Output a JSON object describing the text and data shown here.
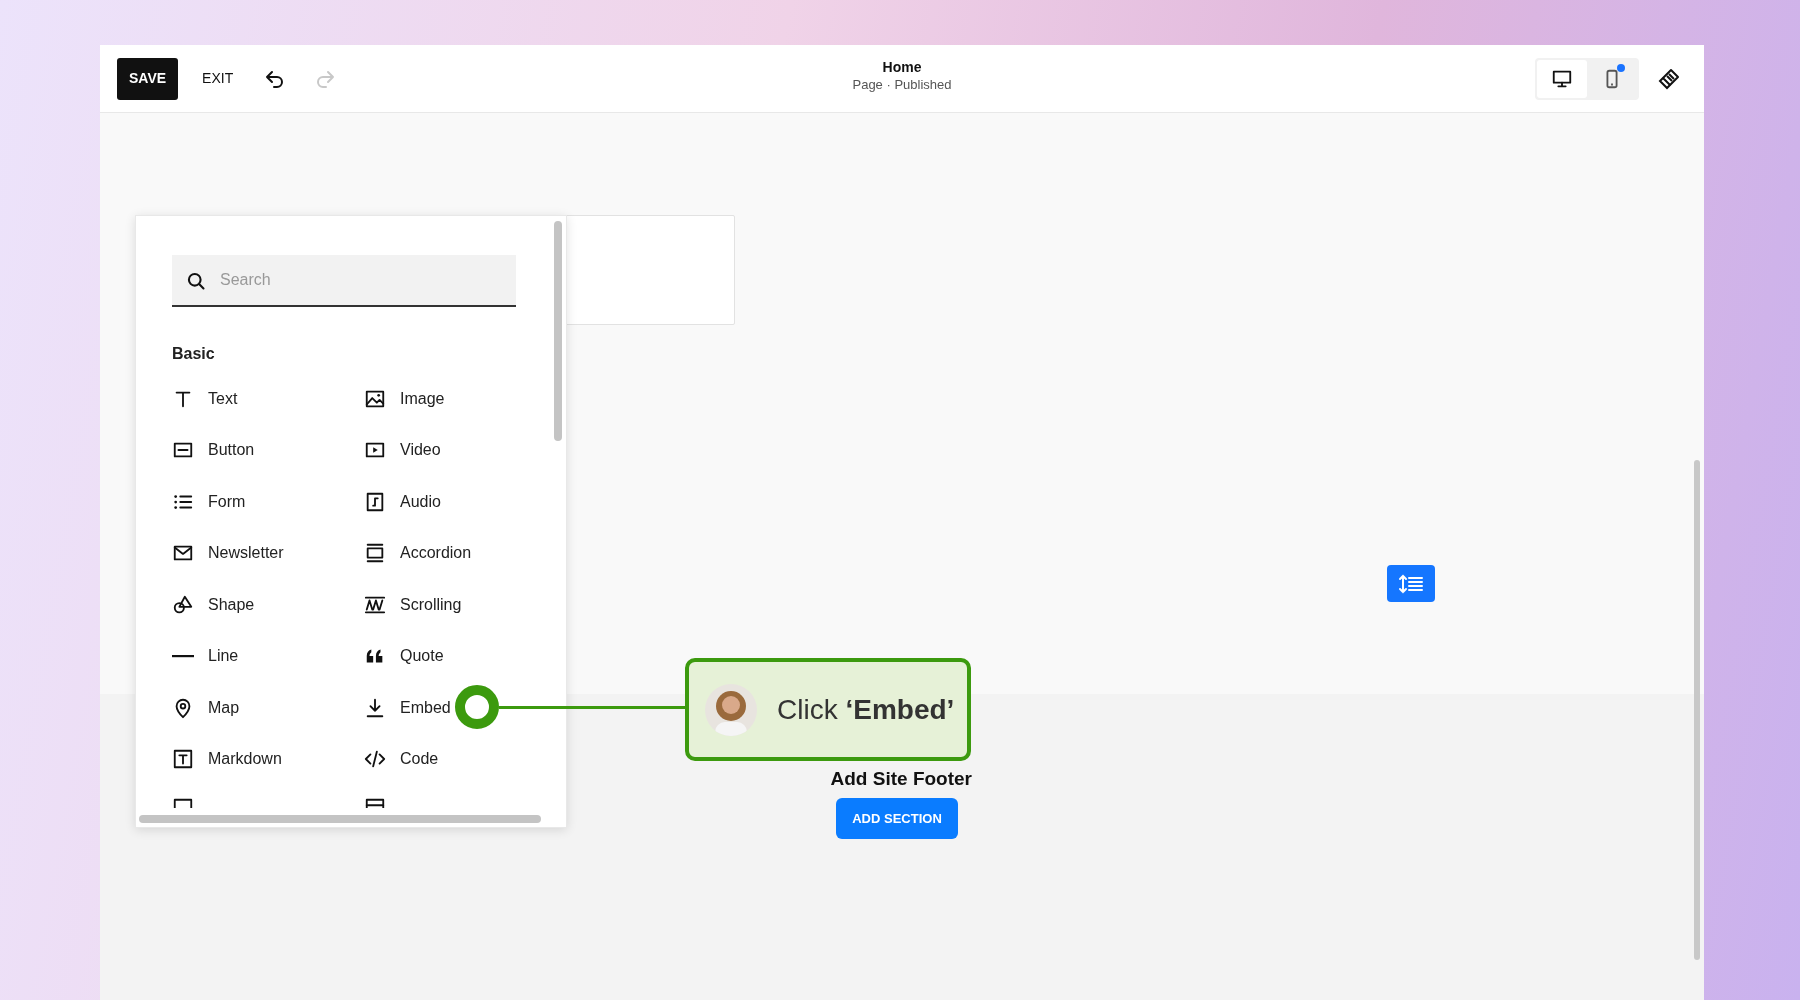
{
  "toolbar": {
    "save": "SAVE",
    "exit": "EXIT",
    "history": [
      {
        "kind": "undo",
        "disabled": false
      },
      {
        "kind": "redo",
        "disabled": true
      }
    ]
  },
  "page": {
    "title": "Home",
    "status": "Page · Published"
  },
  "view_modes": [
    {
      "kind": "desktop",
      "selected": true,
      "notification": false
    },
    {
      "kind": "mobile",
      "selected": false,
      "notification": true
    }
  ],
  "block_panel": {
    "search": {
      "placeholder": "Search"
    },
    "section": "Basic",
    "items": [
      {
        "label": "Text"
      },
      {
        "label": "Image"
      },
      {
        "label": "Button"
      },
      {
        "label": "Video"
      },
      {
        "label": "Form"
      },
      {
        "label": "Audio"
      },
      {
        "label": "Newsletter"
      },
      {
        "label": "Accordion"
      },
      {
        "label": "Shape"
      },
      {
        "label": "Scrolling"
      },
      {
        "label": "Line"
      },
      {
        "label": "Quote"
      },
      {
        "label": "Map"
      },
      {
        "label": "Embed"
      },
      {
        "label": "Markdown"
      },
      {
        "label": "Code"
      }
    ]
  },
  "callout": {
    "text": "Click **‘Embed’**"
  },
  "footer": {
    "title": "Add Site Footer",
    "button": "ADD SECTION"
  }
}
